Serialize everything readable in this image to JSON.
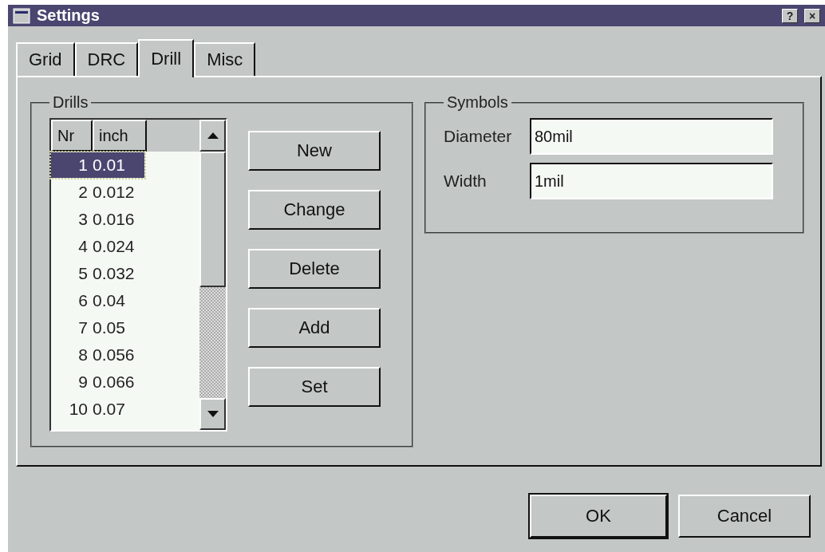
{
  "window": {
    "title": "Settings",
    "help_button": "?",
    "close_button": "×"
  },
  "tabs": [
    {
      "label": "Grid",
      "selected": false
    },
    {
      "label": "DRC",
      "selected": false
    },
    {
      "label": "Drill",
      "selected": true
    },
    {
      "label": "Misc",
      "selected": false
    }
  ],
  "drills": {
    "title": "Drills",
    "columns": [
      "Nr",
      "inch"
    ],
    "rows": [
      {
        "nr": "1",
        "inch": "0.01",
        "selected": true
      },
      {
        "nr": "2",
        "inch": "0.012",
        "selected": false
      },
      {
        "nr": "3",
        "inch": "0.016",
        "selected": false
      },
      {
        "nr": "4",
        "inch": "0.024",
        "selected": false
      },
      {
        "nr": "5",
        "inch": "0.032",
        "selected": false
      },
      {
        "nr": "6",
        "inch": "0.04",
        "selected": false
      },
      {
        "nr": "7",
        "inch": "0.05",
        "selected": false
      },
      {
        "nr": "8",
        "inch": "0.056",
        "selected": false
      },
      {
        "nr": "9",
        "inch": "0.066",
        "selected": false
      },
      {
        "nr": "10",
        "inch": "0.07",
        "selected": false
      }
    ],
    "buttons": [
      "New",
      "Change",
      "Delete",
      "Add",
      "Set"
    ]
  },
  "symbols": {
    "title": "Symbols",
    "fields": [
      {
        "label": "Diameter",
        "value": "80mil"
      },
      {
        "label": "Width",
        "value": "1mil"
      }
    ]
  },
  "footer_buttons": [
    {
      "label": "OK",
      "default": true
    },
    {
      "label": "Cancel",
      "default": false
    }
  ]
}
